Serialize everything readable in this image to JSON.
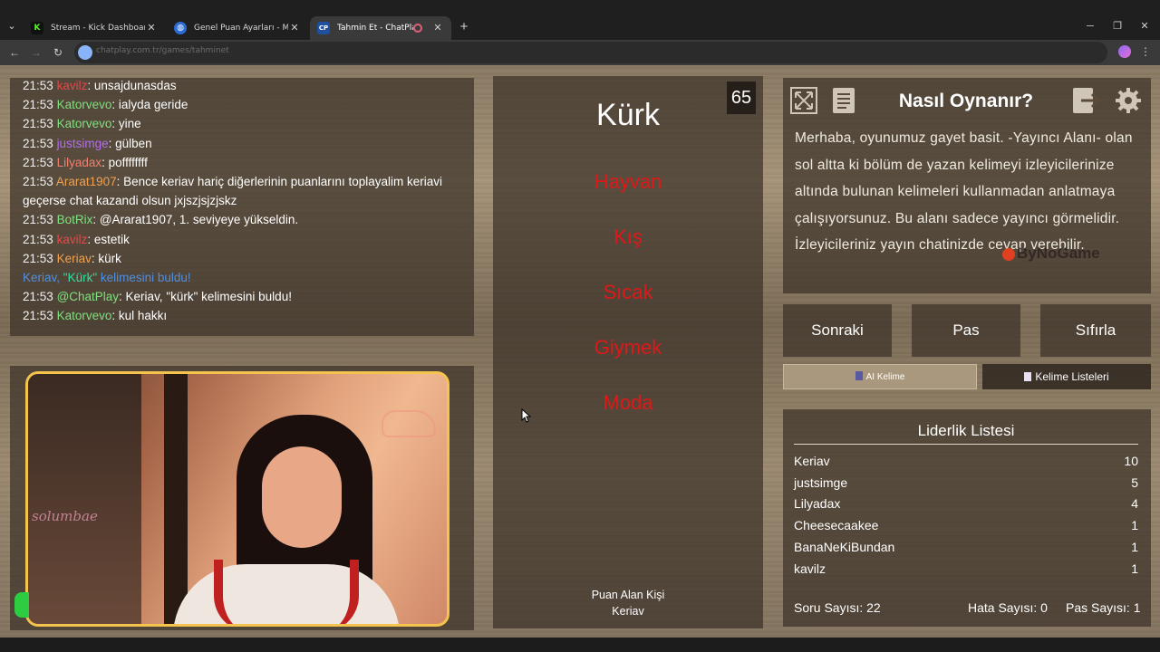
{
  "browser": {
    "tabs": [
      {
        "title": "Stream - Kick Dashboard",
        "favicon": "K",
        "color": "#53fc18",
        "active": false
      },
      {
        "title": "Genel Puan Ayarları - MissXss /...",
        "favicon": "globe",
        "color": "#8ab4f8",
        "active": false
      },
      {
        "title": "Tahmin Et - ChatPlay",
        "favicon": "CP",
        "color": "#4a9aff",
        "active": true
      }
    ],
    "url": "chatplay.com.tr/games/tahminet"
  },
  "chat": {
    "partial_line": {
      "time": "21:53",
      "user": "kavilz",
      "msg": ": unsajdunasdas"
    },
    "lines": [
      {
        "time": "21:53",
        "user": "Katorvevo",
        "color": "green",
        "msg": ": ialyda geride"
      },
      {
        "time": "21:53",
        "user": "Katorvevo",
        "color": "green",
        "msg": ": yine"
      },
      {
        "time": "21:53",
        "user": "justsimge",
        "color": "purple",
        "msg": ": gülben"
      },
      {
        "time": "21:53",
        "user": "Lilyadax",
        "color": "salmon",
        "msg": ": poffffffff"
      },
      {
        "time": "21:53",
        "user": "Ararat1907",
        "color": "orange",
        "msg": ": Bence keriav hariç diğerlerinin puanlarını toplayalim keriavi geçerse chat kazandi olsun jxjszjsjzjskz"
      },
      {
        "time": "21:53",
        "user": "BotRix",
        "color": "green",
        "msg": ": @Ararat1907, 1. seviyeye yükseldin."
      },
      {
        "time": "21:53",
        "user": "kavilz",
        "color": "red",
        "msg": ": estetik"
      },
      {
        "time": "21:53",
        "user": "Keriav",
        "color": "orange",
        "msg": ": kürk"
      }
    ],
    "system_line": {
      "user": "Keriav",
      "word": "\"Kürk\"",
      "msg": " kelimesini buldu!"
    },
    "lines2": [
      {
        "time": "21:53",
        "user": "@ChatPlay",
        "color": "green",
        "msg": ": Keriav, \"kürk\" kelimesini buldu!"
      },
      {
        "time": "21:53",
        "user": "Katorvevo",
        "color": "green",
        "msg": ": kul hakkı"
      }
    ]
  },
  "webcam": {
    "neon_text": "solumbae"
  },
  "game": {
    "timer": "65",
    "word": "Kürk",
    "forbidden": [
      "Hayvan",
      "Kış",
      "Sıcak",
      "Giymek",
      "Moda"
    ],
    "scorer_label": "Puan Alan Kişi",
    "scorer_name": "Keriav"
  },
  "help": {
    "title": "Nasıl Oynanır?",
    "text": "Merhaba, oyunumuz gayet basit. -Yayıncı Alanı- olan sol altta ki bölüm de yazan kelimeyi izleyicilerinize altında bulunan kelimeleri kullanmadan anlatmaya çalışıyorsunuz. Bu alanı sadece yayıncı görmelidir. İzleyicileriniz yayın chatinizde cevap verebilir.",
    "watermark": "ByNoGame"
  },
  "actions": {
    "next": "Sonraki",
    "pass": "Pas",
    "reset": "Sıfırla"
  },
  "tabs": {
    "ai_word": "AI Kelime",
    "word_lists": "Kelime Listeleri"
  },
  "leaderboard": {
    "title": "Liderlik Listesi",
    "rows": [
      {
        "name": "Keriav",
        "score": "10"
      },
      {
        "name": "justsimge",
        "score": "5"
      },
      {
        "name": "Lilyadax",
        "score": "4"
      },
      {
        "name": "Cheesecaakee",
        "score": "1"
      },
      {
        "name": "BanaNeKiBundan",
        "score": "1"
      },
      {
        "name": "kavilz",
        "score": "1"
      }
    ],
    "stats": {
      "questions": "Soru Sayısı: 22",
      "errors": "Hata Sayısı: 0",
      "passes": "Pas Sayısı: 1"
    }
  }
}
